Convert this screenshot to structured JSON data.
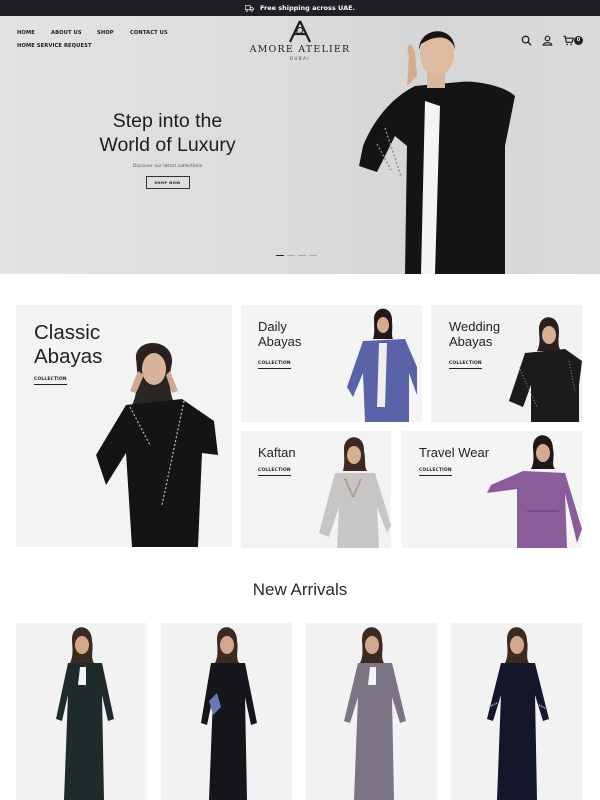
{
  "announcement": {
    "text": "Free shipping across UAE.",
    "icon": "truck-icon"
  },
  "header": {
    "nav": [
      "HOME",
      "ABOUT US",
      "SHOP",
      "CONTACT US",
      "HOME SERVICE REQUEST"
    ],
    "logo": {
      "name": "AMORE ATELIER",
      "city": "DUBAI",
      "monogram": "A"
    },
    "icons": [
      "search-icon",
      "user-icon",
      "cart-icon"
    ],
    "cart_count": "0"
  },
  "hero": {
    "title_line1": "Step into the",
    "title_line2": "World of Luxury",
    "subtitle": "Discover our latest collections",
    "button": "SHOP NOW",
    "slides": 4,
    "active_slide": 1
  },
  "categories": [
    {
      "line1": "Classic",
      "line2": "Abayas",
      "link": "COLLECTION"
    },
    {
      "line1": "Daily",
      "line2": "Abayas",
      "link": "COLLECTION"
    },
    {
      "line1": "Wedding",
      "line2": "Abayas",
      "link": "COLLECTION"
    },
    {
      "line1": "Kaftan",
      "line2": "",
      "link": "COLLECTION"
    },
    {
      "line1": "Travel Wear",
      "line2": "",
      "link": "COLLECTION"
    }
  ],
  "new_arrivals": {
    "title": "New Arrivals"
  },
  "colors": {
    "bar": "#1f1f24",
    "text": "#1c1c1c",
    "tile_bg": "#f1f1f1"
  }
}
